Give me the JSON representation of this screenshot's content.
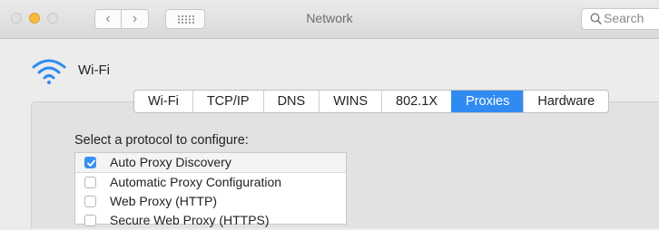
{
  "window": {
    "title": "Network",
    "search_placeholder": "Search"
  },
  "interface": {
    "name": "Wi-Fi",
    "icon": "wifi-icon"
  },
  "tabs": [
    {
      "label": "Wi-Fi",
      "active": false
    },
    {
      "label": "TCP/IP",
      "active": false
    },
    {
      "label": "DNS",
      "active": false
    },
    {
      "label": "WINS",
      "active": false
    },
    {
      "label": "802.1X",
      "active": false
    },
    {
      "label": "Proxies",
      "active": true
    },
    {
      "label": "Hardware",
      "active": false
    }
  ],
  "proxies": {
    "prompt": "Select a protocol to configure:",
    "protocols": [
      {
        "label": "Auto Proxy Discovery",
        "checked": true
      },
      {
        "label": "Automatic Proxy Configuration",
        "checked": false
      },
      {
        "label": "Web Proxy (HTTP)",
        "checked": false
      },
      {
        "label": "Secure Web Proxy (HTTPS)",
        "checked": false
      }
    ]
  },
  "colors": {
    "accent": "#2f8bf2",
    "minimize_light": "#f6bd3a",
    "inactive_light": "#e0e0e0"
  }
}
